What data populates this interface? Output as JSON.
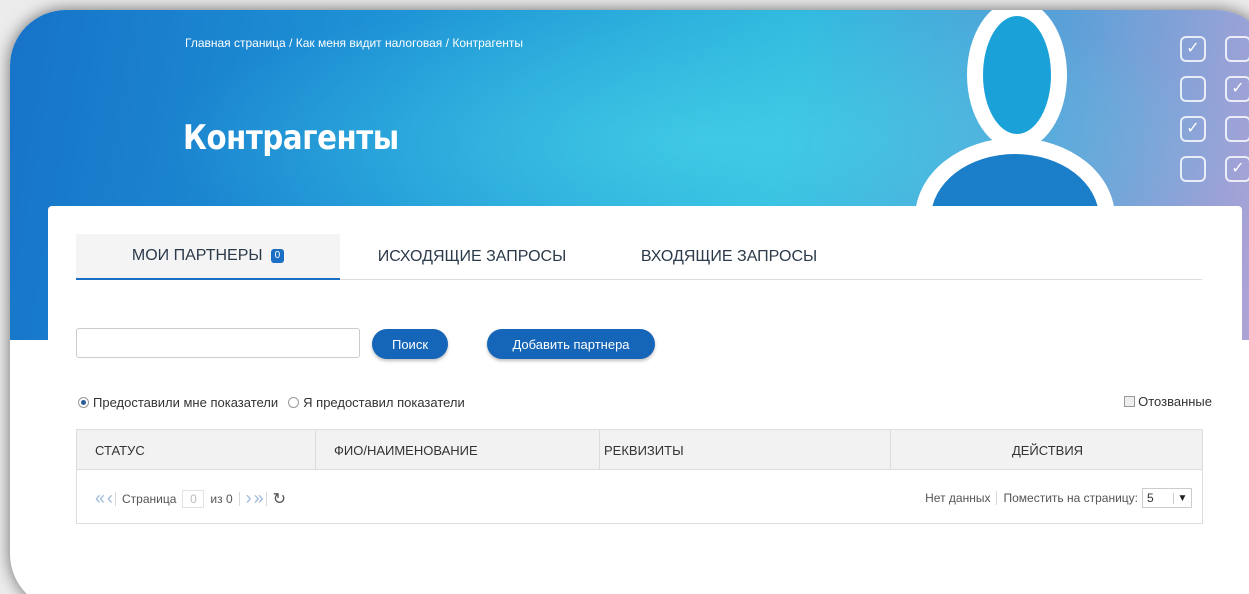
{
  "breadcrumb": {
    "home": "Главная страница",
    "sep1": " / ",
    "section": "Как меня видит налоговая",
    "sep2": " / ",
    "current": "Контрагенты"
  },
  "page": {
    "title": "Контрагенты"
  },
  "tabs": [
    {
      "label": "МОИ ПАРТНЕРЫ",
      "badge": "0",
      "active": true
    },
    {
      "label": "ИСХОДЯЩИЕ ЗАПРОСЫ",
      "active": false
    },
    {
      "label": "ВХОДЯЩИЕ ЗАПРОСЫ",
      "active": false
    }
  ],
  "search": {
    "value": "",
    "placeholder": ""
  },
  "buttons": {
    "search": "Поиск",
    "add_partner": "Добавить партнера"
  },
  "filters": {
    "option1": "Предоставили мне показатели",
    "option2": "Я предоставил показатели",
    "selected": "option1",
    "revoked": "Отозванные",
    "revoked_checked": false
  },
  "table": {
    "columns": [
      "СТАТУС",
      "ФИО/НАИМЕНОВАНИЕ",
      "РЕКВИЗИТЫ",
      "ДЕЙСТВИЯ"
    ],
    "rows": []
  },
  "pager": {
    "page_label": "Страница",
    "page_value": "0",
    "of_label": "из 0",
    "refresh_icon": "refresh-icon",
    "no_data": "Нет данных",
    "per_page_label": "Поместить на страницу:",
    "per_page_value": "5"
  },
  "colors": {
    "accent": "#1565b8",
    "hero_start": "#1773c8",
    "hero_end": "#b6a3d6"
  }
}
